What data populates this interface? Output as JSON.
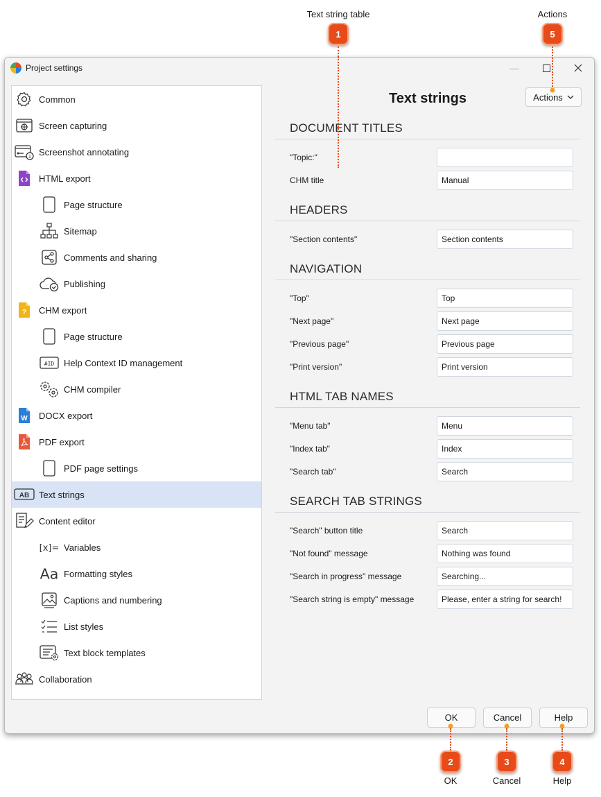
{
  "callouts": {
    "text_string_table": "Text string table",
    "actions": "Actions",
    "ok": "OK",
    "cancel": "Cancel",
    "help": "Help",
    "markers": [
      "1",
      "2",
      "3",
      "4",
      "5"
    ]
  },
  "window": {
    "title": "Project settings",
    "minimize": "—",
    "maximize": "☐",
    "close": "✕"
  },
  "sidebar": {
    "items": [
      {
        "label": "Common",
        "icon": "gear-icon"
      },
      {
        "label": "Screen capturing",
        "icon": "screen-capture-icon"
      },
      {
        "label": "Screenshot annotating",
        "icon": "annotate-icon"
      },
      {
        "label": "HTML export",
        "icon": "html-file-icon"
      },
      {
        "label": "Page structure",
        "icon": "page-icon"
      },
      {
        "label": "Sitemap",
        "icon": "sitemap-icon"
      },
      {
        "label": "Comments and sharing",
        "icon": "share-icon"
      },
      {
        "label": "Publishing",
        "icon": "cloud-check-icon"
      },
      {
        "label": "CHM export",
        "icon": "chm-file-icon"
      },
      {
        "label": "Page structure",
        "icon": "page-icon"
      },
      {
        "label": "Help Context ID management",
        "icon": "id-icon"
      },
      {
        "label": "CHM compiler",
        "icon": "gears-icon"
      },
      {
        "label": "DOCX export",
        "icon": "docx-file-icon"
      },
      {
        "label": "PDF export",
        "icon": "pdf-file-icon"
      },
      {
        "label": "PDF page settings",
        "icon": "page-icon"
      },
      {
        "label": "Text strings",
        "icon": "ab-icon"
      },
      {
        "label": "Content editor",
        "icon": "editor-icon"
      },
      {
        "label": "Variables",
        "icon": "variables-icon"
      },
      {
        "label": "Formatting styles",
        "icon": "font-icon"
      },
      {
        "label": "Captions and numbering",
        "icon": "image-icon"
      },
      {
        "label": "List styles",
        "icon": "checklist-icon"
      },
      {
        "label": "Text block templates",
        "icon": "template-icon"
      },
      {
        "label": "Collaboration",
        "icon": "people-icon"
      }
    ],
    "id_glyph": "#ID",
    "ab_glyph": "AB",
    "var_glyph": "[x]=",
    "font_glyph": "Aa"
  },
  "main": {
    "title": "Text strings",
    "actions_label": "Actions",
    "sections": [
      {
        "title": "DOCUMENT TITLES",
        "rows": [
          {
            "label": "\"Topic:\"",
            "value": ""
          },
          {
            "label": "CHM title",
            "value": "Manual"
          }
        ]
      },
      {
        "title": "HEADERS",
        "rows": [
          {
            "label": "\"Section contents\"",
            "value": "Section contents"
          }
        ]
      },
      {
        "title": "NAVIGATION",
        "rows": [
          {
            "label": "\"Top\"",
            "value": "Top"
          },
          {
            "label": "\"Next page\"",
            "value": "Next page"
          },
          {
            "label": "\"Previous page\"",
            "value": "Previous page"
          },
          {
            "label": "\"Print version\"",
            "value": "Print version"
          }
        ]
      },
      {
        "title": "HTML TAB NAMES",
        "rows": [
          {
            "label": "\"Menu tab\"",
            "value": "Menu"
          },
          {
            "label": "\"Index tab\"",
            "value": "Index"
          },
          {
            "label": "\"Search tab\"",
            "value": "Search"
          }
        ]
      },
      {
        "title": "SEARCH TAB STRINGS",
        "rows": [
          {
            "label": "\"Search\" button title",
            "value": "Search"
          },
          {
            "label": "\"Not found\" message",
            "value": "Nothing was found"
          },
          {
            "label": "\"Search in progress\" message",
            "value": "Searching..."
          },
          {
            "label": "\"Search string is empty\" message",
            "value": "Please, enter a string for search!"
          }
        ]
      }
    ]
  },
  "footer": {
    "ok": "OK",
    "cancel": "Cancel",
    "help": "Help"
  },
  "colors": {
    "marker": "#e84b1a",
    "selected": "#d8e4f5",
    "html_icon": "#8e44c9",
    "chm_icon": "#f0b51a",
    "docx_icon": "#2b7fd6",
    "pdf_icon": "#e8583a"
  }
}
